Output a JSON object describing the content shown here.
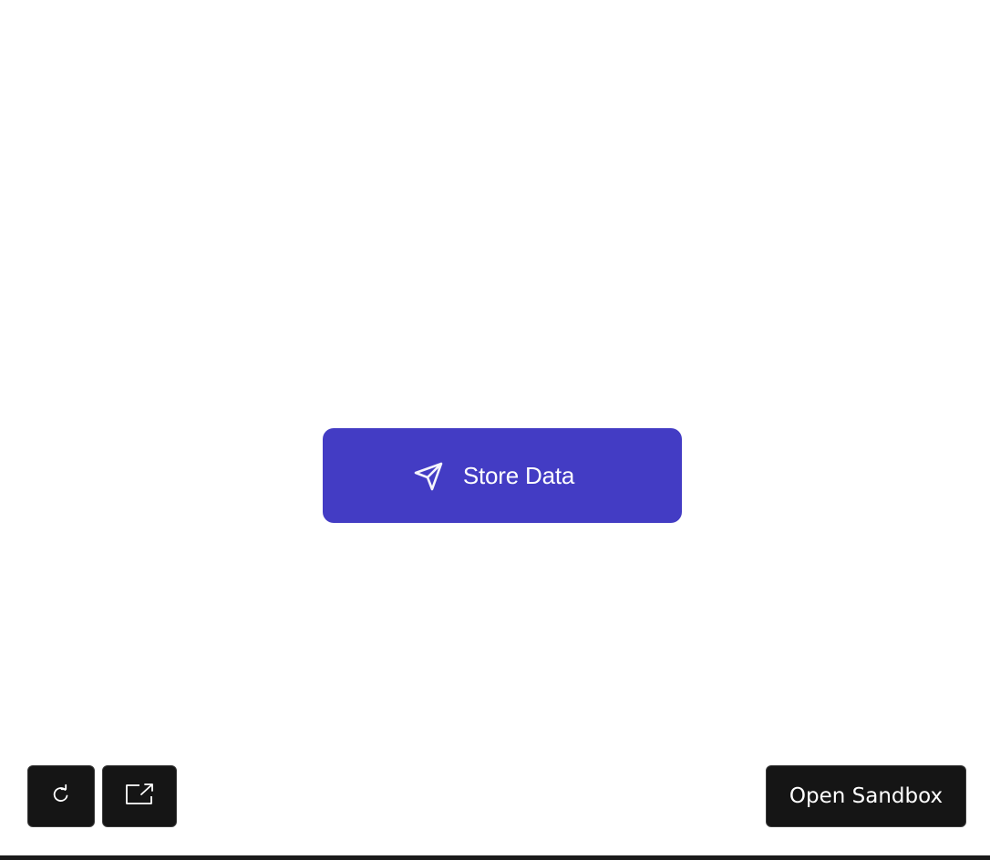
{
  "main_action": {
    "label": "Store Data",
    "icon": "send-icon",
    "background_color": "#433cc4"
  },
  "toolbar": {
    "refresh_icon": "refresh-icon",
    "popout_icon": "external-link-icon",
    "sandbox_label": "Open Sandbox",
    "button_color": "#151515"
  }
}
